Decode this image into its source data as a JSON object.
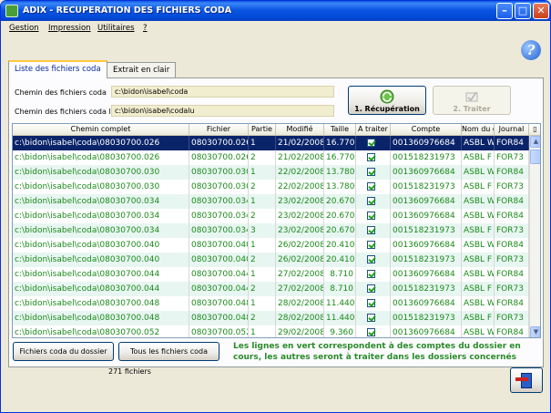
{
  "window": {
    "title": "ADIX - RECUPERATION DES FICHIERS CODA"
  },
  "menu": [
    "Gestion",
    "Impression",
    "Utilitaires",
    "?"
  ],
  "tabs": [
    "Liste des fichiers coda",
    "Extrait en clair"
  ],
  "paths": {
    "chemin_label": "Chemin des fichiers coda",
    "chemin_value": "c:\\bidon\\isabel\\coda",
    "chemin_lus_label": "Chemin des fichiers coda lus",
    "chemin_lus_value": "c:\\bidon\\isabel\\codalu"
  },
  "buttons": {
    "recuperation": "1. Récupération",
    "traiter": "2. Traiter",
    "fichiers_dossier": "Fichiers coda du dossier",
    "tous_fichiers": "Tous les fichiers coda"
  },
  "table": {
    "columns": [
      "Chemin complet",
      "Fichier",
      "Partie",
      "Modifié",
      "Taille",
      "A traiter",
      "Compte",
      "Nom du d",
      "Journal"
    ],
    "rows": [
      {
        "path": "c:\\bidon\\isabel\\coda\\08030700.026",
        "file": "08030700.026",
        "part": "1",
        "date": "21/02/2008",
        "size": "16.770",
        "compte": "001360976684",
        "nom": "ASBL W",
        "journal": "FOR84",
        "selected": true,
        "green": false
      },
      {
        "path": "c:\\bidon\\isabel\\coda\\08030700.026",
        "file": "08030700.026",
        "part": "2",
        "date": "21/02/2008",
        "size": "16.770",
        "compte": "001518231973",
        "nom": "ASBL F",
        "journal": "FOR73",
        "selected": false,
        "green": true
      },
      {
        "path": "c:\\bidon\\isabel\\coda\\08030700.030",
        "file": "08030700.030",
        "part": "1",
        "date": "22/02/2008",
        "size": "13.780",
        "compte": "001360976684",
        "nom": "ASBL W",
        "journal": "FOR84",
        "selected": false,
        "green": true
      },
      {
        "path": "c:\\bidon\\isabel\\coda\\08030700.030",
        "file": "08030700.030",
        "part": "2",
        "date": "22/02/2008",
        "size": "13.780",
        "compte": "001518231973",
        "nom": "ASBL F",
        "journal": "FOR73",
        "selected": false,
        "green": true
      },
      {
        "path": "c:\\bidon\\isabel\\coda\\08030700.034",
        "file": "08030700.034",
        "part": "1",
        "date": "23/02/2008",
        "size": "20.670",
        "compte": "001360976684",
        "nom": "ASBL W",
        "journal": "FOR84",
        "selected": false,
        "green": true
      },
      {
        "path": "c:\\bidon\\isabel\\coda\\08030700.034",
        "file": "08030700.034",
        "part": "2",
        "date": "23/02/2008",
        "size": "20.670",
        "compte": "001360976684",
        "nom": "ASBL W",
        "journal": "FOR84",
        "selected": false,
        "green": true
      },
      {
        "path": "c:\\bidon\\isabel\\coda\\08030700.034",
        "file": "08030700.034",
        "part": "3",
        "date": "23/02/2008",
        "size": "20.670",
        "compte": "001518231973",
        "nom": "ASBL F",
        "journal": "FOR73",
        "selected": false,
        "green": true
      },
      {
        "path": "c:\\bidon\\isabel\\coda\\08030700.040",
        "file": "08030700.040",
        "part": "1",
        "date": "26/02/2008",
        "size": "20.410",
        "compte": "001360976684",
        "nom": "ASBL W",
        "journal": "FOR84",
        "selected": false,
        "green": true
      },
      {
        "path": "c:\\bidon\\isabel\\coda\\08030700.040",
        "file": "08030700.040",
        "part": "2",
        "date": "26/02/2008",
        "size": "20.410",
        "compte": "001518231973",
        "nom": "ASBL F",
        "journal": "FOR73",
        "selected": false,
        "green": true
      },
      {
        "path": "c:\\bidon\\isabel\\coda\\08030700.044",
        "file": "08030700.044",
        "part": "1",
        "date": "27/02/2008",
        "size": "8.710",
        "compte": "001360976684",
        "nom": "ASBL W",
        "journal": "FOR84",
        "selected": false,
        "green": true
      },
      {
        "path": "c:\\bidon\\isabel\\coda\\08030700.044",
        "file": "08030700.044",
        "part": "2",
        "date": "27/02/2008",
        "size": "8.710",
        "compte": "001518231973",
        "nom": "ASBL F",
        "journal": "FOR73",
        "selected": false,
        "green": true
      },
      {
        "path": "c:\\bidon\\isabel\\coda\\08030700.048",
        "file": "08030700.048",
        "part": "1",
        "date": "28/02/2008",
        "size": "11.440",
        "compte": "001360976684",
        "nom": "ASBL W",
        "journal": "FOR84",
        "selected": false,
        "green": true
      },
      {
        "path": "c:\\bidon\\isabel\\coda\\08030700.048",
        "file": "08030700.048",
        "part": "2",
        "date": "28/02/2008",
        "size": "11.440",
        "compte": "001518231973",
        "nom": "ASBL F",
        "journal": "FOR73",
        "selected": false,
        "green": true
      },
      {
        "path": "c:\\bidon\\isabel\\coda\\08030700.052",
        "file": "08030700.052",
        "part": "1",
        "date": "29/02/2008",
        "size": "9.360",
        "compte": "001360976684",
        "nom": "ASBL W",
        "journal": "FOR84",
        "selected": false,
        "green": true
      }
    ]
  },
  "legend": "Les lignes en vert correspondent à des comptes du dossier en cours, les autres seront à traiter dans les dossiers concernés",
  "status": {
    "count": "271 fichiers"
  }
}
